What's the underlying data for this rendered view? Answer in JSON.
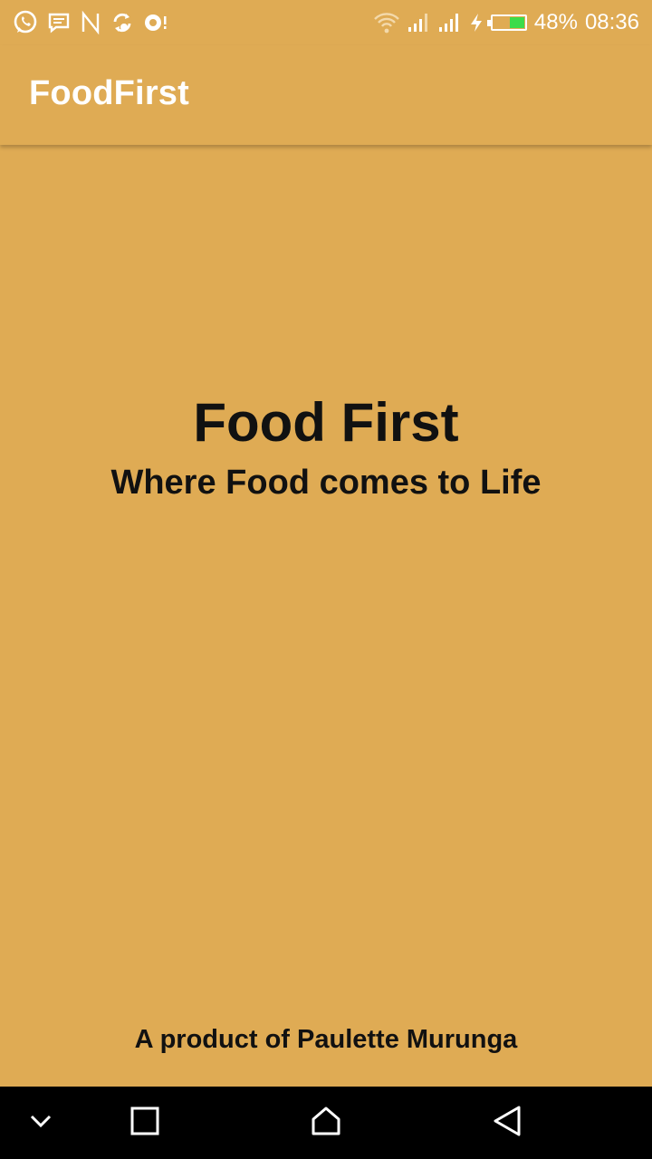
{
  "status_bar": {
    "battery_percent_label": "48%",
    "battery_level": 0.48,
    "time": "08:36",
    "notification_icons": [
      "whatsapp-icon",
      "message-icon",
      "n-logo-icon",
      "sync-icon",
      "camera-notification-icon"
    ],
    "system_icons": [
      "wifi-icon",
      "signal-icon",
      "signal-icon",
      "charging-icon",
      "battery-icon"
    ],
    "battery_color": "#3ddc4a"
  },
  "app_bar": {
    "title": "FoodFirst"
  },
  "main": {
    "title": "Food First",
    "subtitle": "Where Food comes to Life",
    "credit": "A product of Paulette Murunga"
  },
  "nav_bar": {
    "buttons": [
      "chevron-down-icon",
      "recents-icon",
      "home-icon",
      "back-icon"
    ]
  },
  "colors": {
    "background": "#dfab54",
    "text_dark": "#111111",
    "text_light": "#ffffff",
    "nav_background": "#000000"
  }
}
